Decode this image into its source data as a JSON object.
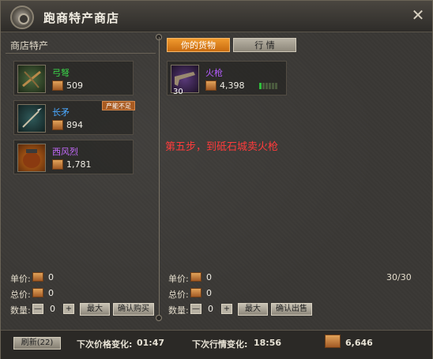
{
  "title": "跑商特产商店",
  "left": {
    "header": "商店特产",
    "items": [
      {
        "name": "弓弩",
        "price": "509",
        "name_color": "#3bd94a"
      },
      {
        "name": "长矛",
        "price": "894",
        "name_color": "#4aa8ff",
        "badge": "产能不足"
      },
      {
        "name": "西风烈",
        "price": "1,781",
        "name_color": "#c66bff"
      }
    ],
    "unit_price_label": "单价:",
    "unit_price": "0",
    "total_price_label": "总价:",
    "total_price": "0",
    "qty_label": "数量:",
    "qty_value": "0",
    "minus": "—",
    "plus": "+",
    "max_label": "最大",
    "confirm_label": "确认购买"
  },
  "right": {
    "tabs": {
      "goods": "你的货物",
      "market": "行 情"
    },
    "goods": [
      {
        "name": "火枪",
        "price": "4,398",
        "quantity": "30",
        "name_color": "#b45cff",
        "supply_level": 1,
        "supply_max": 6
      }
    ],
    "note": "第五步，到砥石城卖火枪",
    "unit_price_label": "单价:",
    "unit_price": "0",
    "total_price_label": "总价:",
    "total_price": "0",
    "qty_label": "数量:",
    "qty_value": "0",
    "minus": "—",
    "plus": "+",
    "max_label": "最大",
    "confirm_label": "确认出售",
    "stock": "30/30"
  },
  "bottom": {
    "refresh_label": "刷新(22)",
    "next_price_label": "下次价格变化:",
    "next_price_time": "01:47",
    "next_market_label": "下次行情变化:",
    "next_market_time": "18:56",
    "money": "6,646"
  },
  "colors": {
    "accent": "#f09a2e",
    "note": "#ff3b3b",
    "supply_on": "#2fbf3c",
    "supply_off": "#4a5a3e"
  }
}
